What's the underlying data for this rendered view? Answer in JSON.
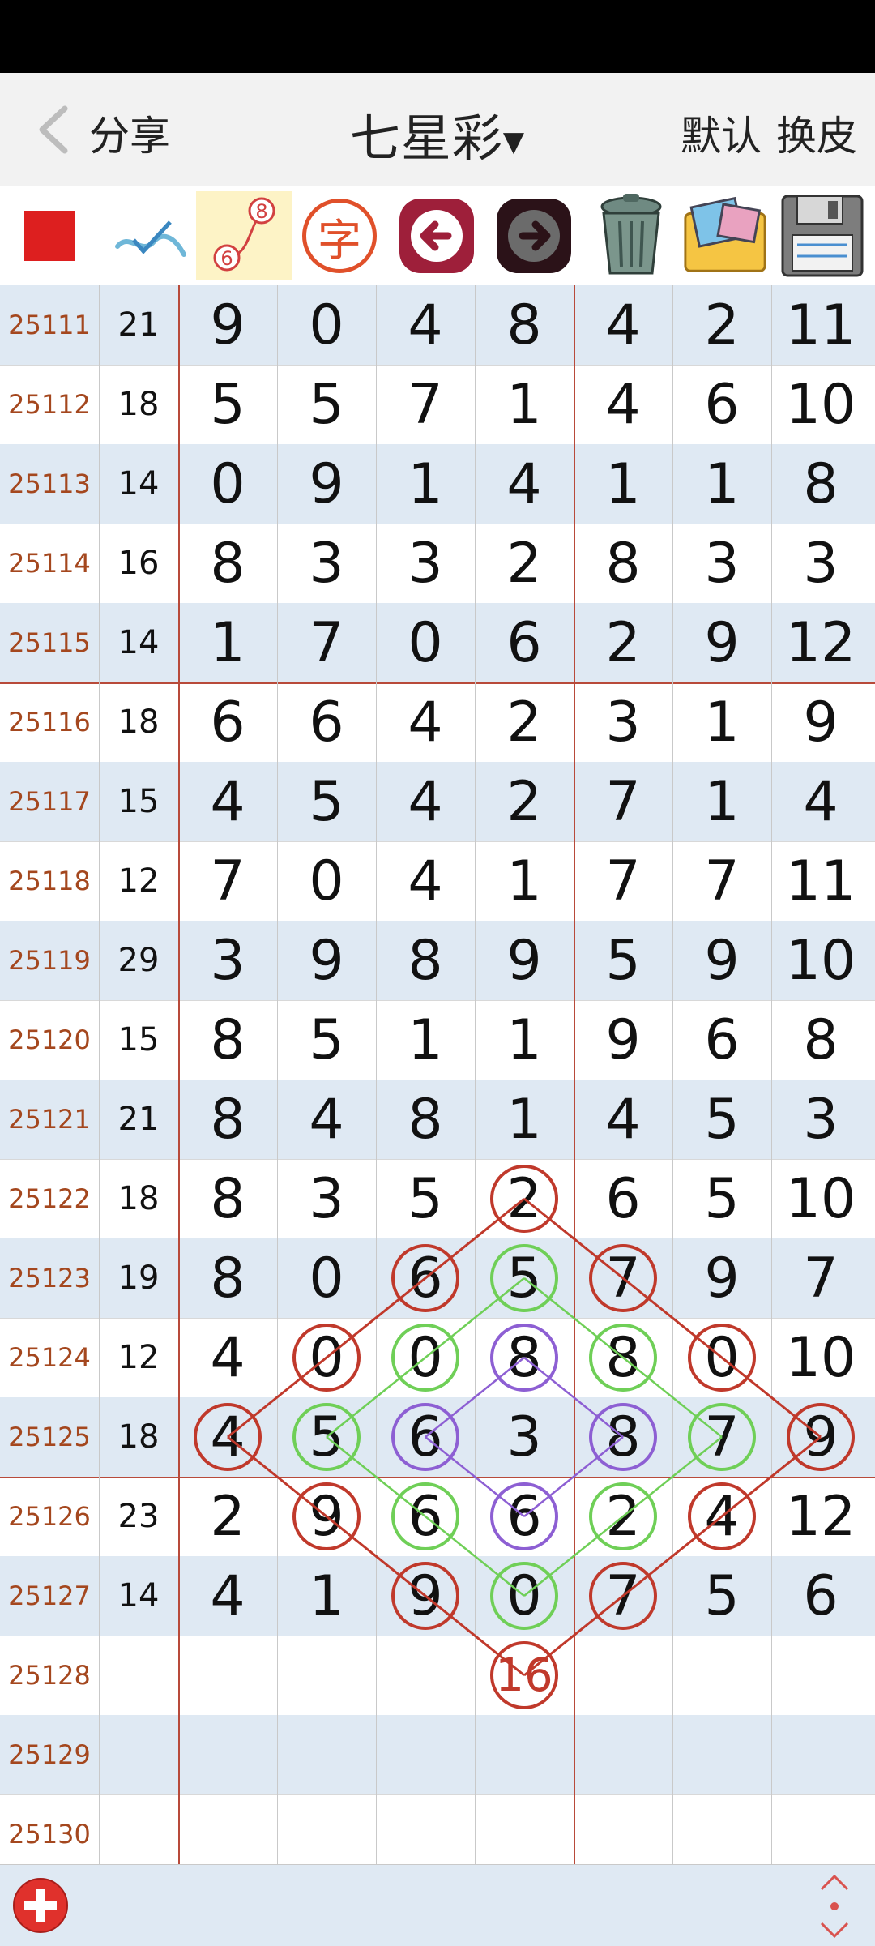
{
  "header": {
    "share_label": "分享",
    "title": "七星彩",
    "default_label": "默认",
    "skin_label": "换皮"
  },
  "toolbar": {
    "icons": [
      "stop-icon",
      "pen-icon",
      "connect-icon",
      "character-icon",
      "back-arrow-icon",
      "forward-arrow-icon",
      "trash-icon",
      "photo-album-icon",
      "save-disk-icon"
    ],
    "connect_icon_top_number": "8",
    "connect_icon_bottom_number": "6",
    "character_icon_glyph": "字"
  },
  "rows": [
    {
      "issue": "25111",
      "sum": "21",
      "nums": [
        "9",
        "0",
        "4",
        "8",
        "4",
        "2",
        "11"
      ]
    },
    {
      "issue": "25112",
      "sum": "18",
      "nums": [
        "5",
        "5",
        "7",
        "1",
        "4",
        "6",
        "10"
      ]
    },
    {
      "issue": "25113",
      "sum": "14",
      "nums": [
        "0",
        "9",
        "1",
        "4",
        "1",
        "1",
        "8"
      ]
    },
    {
      "issue": "25114",
      "sum": "16",
      "nums": [
        "8",
        "3",
        "3",
        "2",
        "8",
        "3",
        "3"
      ]
    },
    {
      "issue": "25115",
      "sum": "14",
      "nums": [
        "1",
        "7",
        "0",
        "6",
        "2",
        "9",
        "12"
      ]
    },
    {
      "issue": "25116",
      "sum": "18",
      "nums": [
        "6",
        "6",
        "4",
        "2",
        "3",
        "1",
        "9"
      ]
    },
    {
      "issue": "25117",
      "sum": "15",
      "nums": [
        "4",
        "5",
        "4",
        "2",
        "7",
        "1",
        "4"
      ]
    },
    {
      "issue": "25118",
      "sum": "12",
      "nums": [
        "7",
        "0",
        "4",
        "1",
        "7",
        "7",
        "11"
      ]
    },
    {
      "issue": "25119",
      "sum": "29",
      "nums": [
        "3",
        "9",
        "8",
        "9",
        "5",
        "9",
        "10"
      ]
    },
    {
      "issue": "25120",
      "sum": "15",
      "nums": [
        "8",
        "5",
        "1",
        "1",
        "9",
        "6",
        "8"
      ]
    },
    {
      "issue": "25121",
      "sum": "21",
      "nums": [
        "8",
        "4",
        "8",
        "1",
        "4",
        "5",
        "3"
      ]
    },
    {
      "issue": "25122",
      "sum": "18",
      "nums": [
        "8",
        "3",
        "5",
        "2",
        "6",
        "5",
        "10"
      ]
    },
    {
      "issue": "25123",
      "sum": "19",
      "nums": [
        "8",
        "0",
        "6",
        "5",
        "7",
        "9",
        "7"
      ]
    },
    {
      "issue": "25124",
      "sum": "12",
      "nums": [
        "4",
        "0",
        "0",
        "8",
        "8",
        "0",
        "10"
      ]
    },
    {
      "issue": "25125",
      "sum": "18",
      "nums": [
        "4",
        "5",
        "6",
        "3",
        "8",
        "7",
        "9"
      ]
    },
    {
      "issue": "25126",
      "sum": "23",
      "nums": [
        "2",
        "9",
        "6",
        "6",
        "2",
        "4",
        "12"
      ]
    },
    {
      "issue": "25127",
      "sum": "14",
      "nums": [
        "4",
        "1",
        "9",
        "0",
        "7",
        "5",
        "6"
      ]
    },
    {
      "issue": "25128",
      "sum": "",
      "nums": [
        "",
        "",
        "",
        "16",
        "",
        "",
        ""
      ]
    },
    {
      "issue": "25129",
      "sum": "",
      "nums": [
        "",
        "",
        "",
        "",
        "",
        "",
        ""
      ]
    },
    {
      "issue": "25130",
      "sum": "",
      "nums": [
        "",
        "",
        "",
        "",
        "",
        "",
        ""
      ]
    }
  ],
  "annotations": {
    "red_circles": [
      [
        11,
        3
      ],
      [
        12,
        2
      ],
      [
        12,
        4
      ],
      [
        13,
        1
      ],
      [
        13,
        5
      ],
      [
        14,
        0
      ],
      [
        14,
        6
      ],
      [
        15,
        1
      ],
      [
        15,
        5
      ],
      [
        16,
        2
      ],
      [
        16,
        4
      ],
      [
        17,
        3
      ]
    ],
    "green_circles": [
      [
        12,
        3
      ],
      [
        13,
        2
      ],
      [
        13,
        4
      ],
      [
        14,
        1
      ],
      [
        14,
        5
      ],
      [
        15,
        2
      ],
      [
        15,
        4
      ],
      [
        16,
        3
      ]
    ],
    "purple_circles": [
      [
        13,
        3
      ],
      [
        14,
        2
      ],
      [
        14,
        4
      ],
      [
        15,
        3
      ]
    ],
    "colors": {
      "red": "#c0392b",
      "green": "#6fcf57",
      "purple": "#8d5fd3"
    }
  },
  "bottom": {
    "icons": [
      "add-icon",
      "scroll-updown-icon"
    ]
  }
}
